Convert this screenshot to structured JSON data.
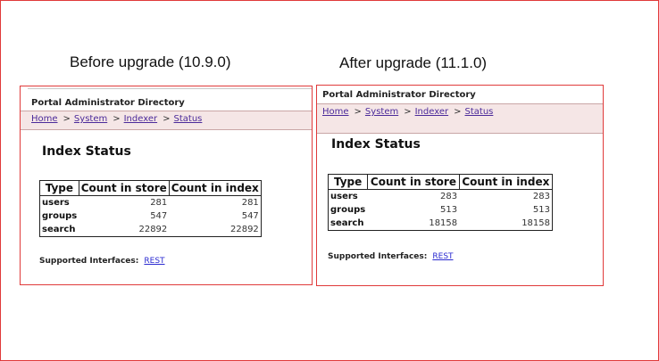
{
  "before": {
    "caption": "Before upgrade (10.9.0)",
    "directory_title": "Portal Administrator Directory",
    "breadcrumbs": [
      "Home",
      "System",
      "Indexer",
      "Status"
    ],
    "index_title": "Index Status",
    "table": {
      "headers": [
        "Type",
        "Count in store",
        "Count in index"
      ],
      "rows": [
        {
          "type": "users",
          "store": "281",
          "index": "281"
        },
        {
          "type": "groups",
          "store": "547",
          "index": "547"
        },
        {
          "type": "search",
          "store": "22892",
          "index": "22892"
        }
      ]
    },
    "supported_label": "Supported Interfaces:",
    "supported_link": "REST"
  },
  "after": {
    "caption": "After upgrade (11.1.0)",
    "directory_title": "Portal Administrator Directory",
    "breadcrumbs": [
      "Home",
      "System",
      "Indexer",
      "Status"
    ],
    "index_title": "Index Status",
    "table": {
      "headers": [
        "Type",
        "Count in store",
        "Count in index"
      ],
      "rows": [
        {
          "type": "users",
          "store": "283",
          "index": "283"
        },
        {
          "type": "groups",
          "store": "513",
          "index": "513"
        },
        {
          "type": "search",
          "store": "18158",
          "index": "18158"
        }
      ]
    },
    "supported_label": "Supported Interfaces:",
    "supported_link": "REST"
  },
  "colors": {
    "frame_border": "#e03a3a",
    "breadcrumb_bg": "#f5e6e6",
    "link": "#4b2a9a",
    "rest_link": "#2a2ad0"
  }
}
